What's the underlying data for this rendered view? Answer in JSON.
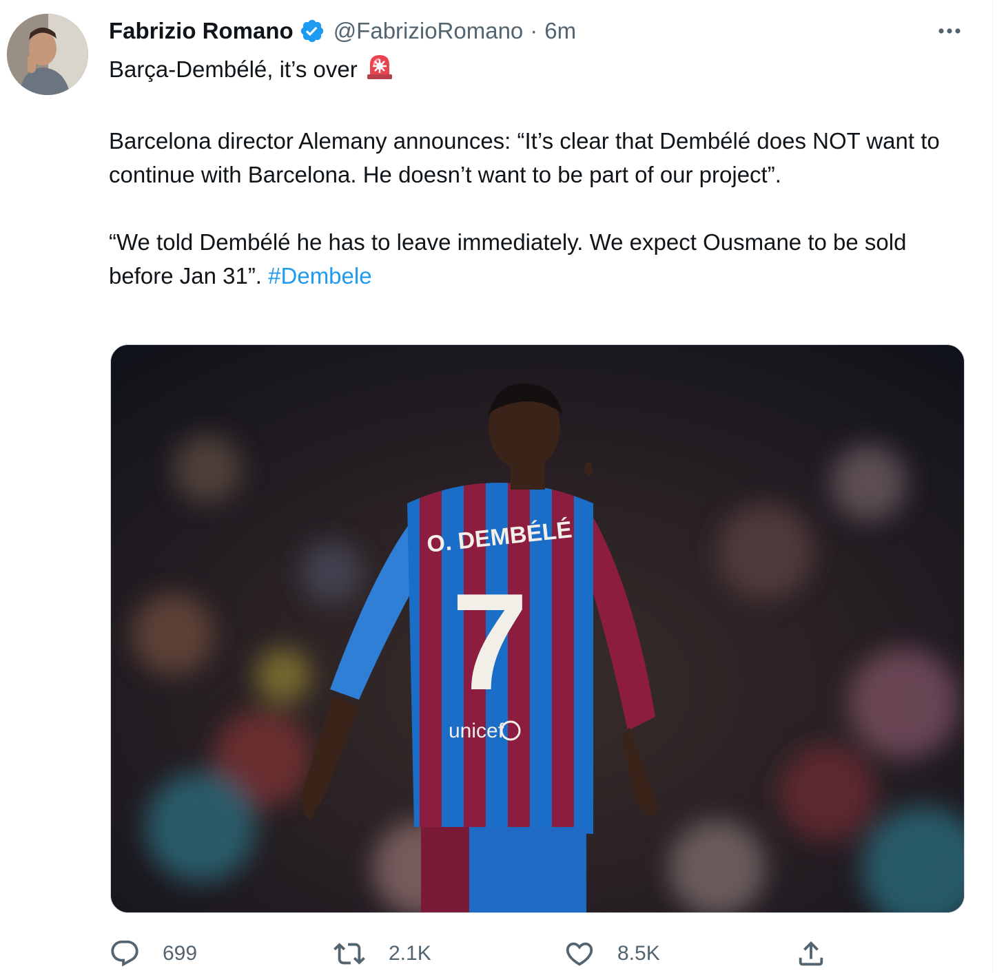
{
  "tweet": {
    "author": {
      "name": "Fabrizio Romano",
      "handle": "@FabrizioRomano",
      "verified": true
    },
    "separator": "·",
    "timestamp": "6m",
    "text": {
      "line1": "Barça-Dembélé, it’s over",
      "line1_emoji": "police-siren-icon",
      "para2": "Barcelona director Alemany announces: “It’s clear that Dembélé does NOT want to continue with Barcelona. He doesn’t want to be part of our project”.",
      "para3": "“We told Dembélé he has to leave immediately. We expect Ousmane to be sold before Jan 31”.",
      "hashtag": "#Dembele"
    },
    "media": {
      "jersey_name": "O. DEMBÉLÉ",
      "jersey_number": "7",
      "jersey_sponsor": "unicef"
    },
    "actions": {
      "replies": "699",
      "retweets": "2.1K",
      "likes": "8.5K"
    }
  },
  "colors": {
    "link": "#1d9bf0",
    "secondary_text": "#536471",
    "verified": "#1d9bf0",
    "barca_blue": "#1a6ec8",
    "barca_garnet": "#8c1d3f"
  }
}
